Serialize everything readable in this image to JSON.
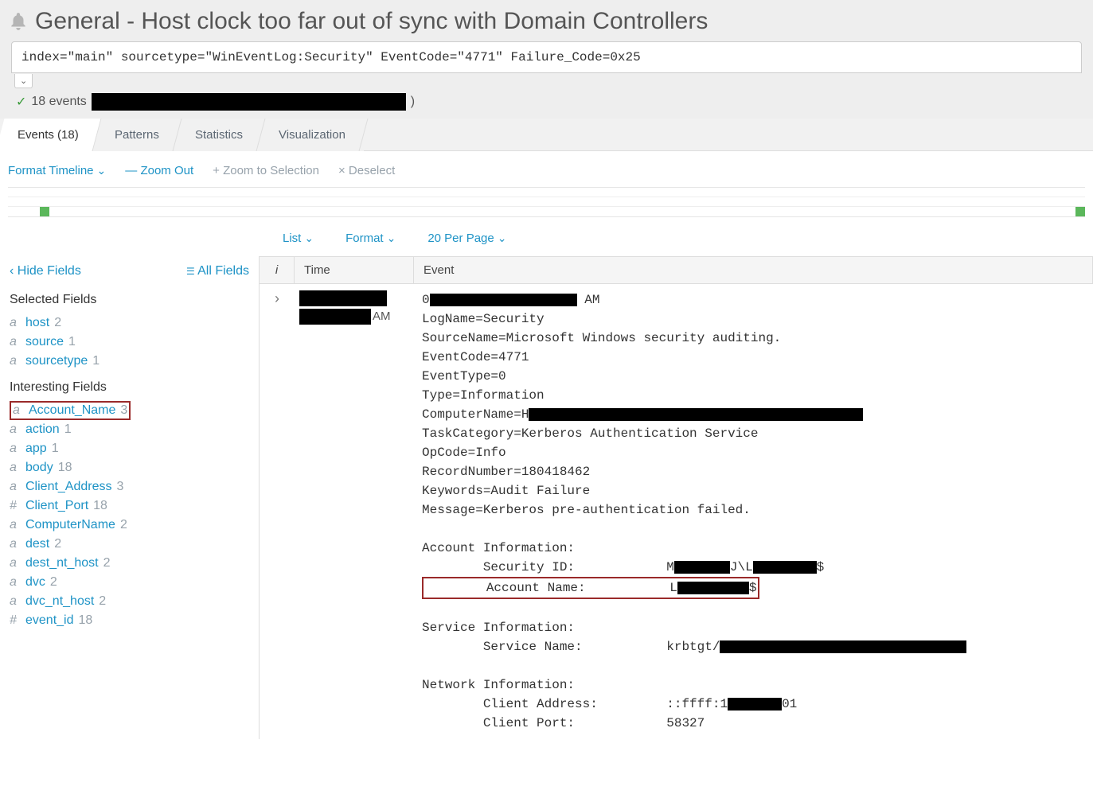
{
  "header": {
    "title": "General - Host clock too far out of sync with Domain Controllers",
    "search_query": "index=\"main\" sourcetype=\"WinEventLog:Security\" EventCode=\"4771\" Failure_Code=0x25",
    "events_count_text": "18 events",
    "events_suffix": ")"
  },
  "tabs": {
    "events": "Events (18)",
    "patterns": "Patterns",
    "statistics": "Statistics",
    "visualization": "Visualization"
  },
  "timeline_controls": {
    "format": "Format Timeline",
    "zoom_out": "Zoom Out",
    "zoom_sel": "Zoom to Selection",
    "deselect": "Deselect"
  },
  "content_controls": {
    "list": "List",
    "format": "Format",
    "per_page": "20 Per Page"
  },
  "sidebar": {
    "hide": "Hide Fields",
    "all": "All Fields",
    "selected_heading": "Selected Fields",
    "interesting_heading": "Interesting Fields",
    "selected": [
      {
        "t": "a",
        "name": "host",
        "count": "2"
      },
      {
        "t": "a",
        "name": "source",
        "count": "1"
      },
      {
        "t": "a",
        "name": "sourcetype",
        "count": "1"
      }
    ],
    "interesting": [
      {
        "t": "a",
        "name": "Account_Name",
        "count": "3",
        "hl": true
      },
      {
        "t": "a",
        "name": "action",
        "count": "1"
      },
      {
        "t": "a",
        "name": "app",
        "count": "1"
      },
      {
        "t": "a",
        "name": "body",
        "count": "18"
      },
      {
        "t": "a",
        "name": "Client_Address",
        "count": "3"
      },
      {
        "t": "#",
        "name": "Client_Port",
        "count": "18"
      },
      {
        "t": "a",
        "name": "ComputerName",
        "count": "2"
      },
      {
        "t": "a",
        "name": "dest",
        "count": "2"
      },
      {
        "t": "a",
        "name": "dest_nt_host",
        "count": "2"
      },
      {
        "t": "a",
        "name": "dvc",
        "count": "2"
      },
      {
        "t": "a",
        "name": "dvc_nt_host",
        "count": "2"
      },
      {
        "t": "#",
        "name": "event_id",
        "count": "18"
      }
    ]
  },
  "results_header": {
    "i": "i",
    "time": "Time",
    "event": "Event"
  },
  "event": {
    "time_am": "AM",
    "l0a": "0",
    "l0b": " AM",
    "l1": "LogName=Security",
    "l2": "SourceName=Microsoft Windows security auditing.",
    "l3": "EventCode=4771",
    "l4": "EventType=0",
    "l5": "Type=Information",
    "l6a": "ComputerName=H",
    "l7": "TaskCategory=Kerberos Authentication Service",
    "l8": "OpCode=Info",
    "l9": "RecordNumber=180418462",
    "l10": "Keywords=Audit Failure",
    "l11": "Message=Kerberos pre-authentication failed.",
    "blank": "",
    "l12": "Account Information:",
    "l13a": "        Security ID:            M",
    "l13b": "J\\L",
    "l13c": "$",
    "l14a": "        Account Name:           L",
    "l14b": "$",
    "l15": "Service Information:",
    "l16a": "        Service Name:           krbtgt/",
    "l17": "Network Information:",
    "l18a": "        Client Address:         ::ffff:1",
    "l18b": "01",
    "l19": "        Client Port:            58327"
  }
}
